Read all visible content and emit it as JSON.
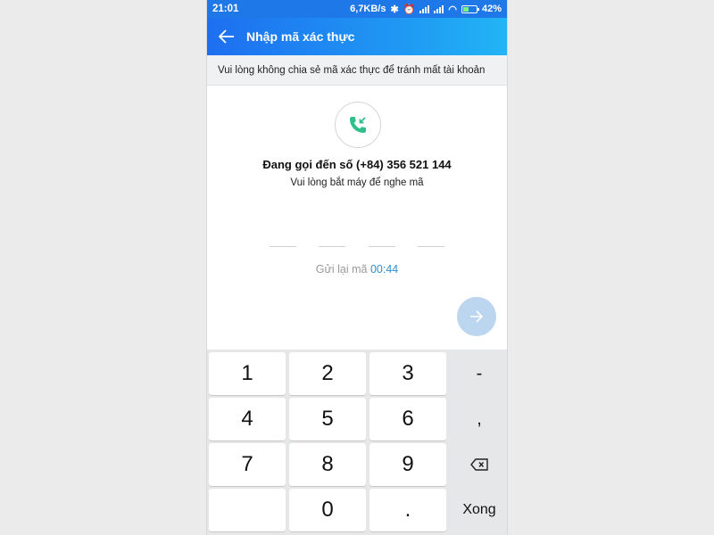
{
  "status_bar": {
    "time": "21:01",
    "speed": "6,7KB/s",
    "battery": "42%"
  },
  "header": {
    "title": "Nhập mã xác thực"
  },
  "notice": "Vui lòng không chia sẻ mã xác thực để tránh mất tài khoản",
  "call": {
    "title": "Đang gọi đến số (+84) 356 521 144",
    "subtitle": "Vui lòng bắt máy để nghe mã"
  },
  "otp_fields": [
    "",
    "",
    "",
    ""
  ],
  "resend": {
    "label": "Gửi lại mã",
    "countdown": "00:44"
  },
  "keypad": {
    "k1": "1",
    "k2": "2",
    "k3": "3",
    "dash": "-",
    "k4": "4",
    "k5": "5",
    "k6": "6",
    "comma": ",",
    "k7": "7",
    "k8": "8",
    "k9": "9",
    "k0": "0",
    "dot": ".",
    "done": "Xong"
  },
  "colors": {
    "accent": "#1f78e8",
    "call_icon": "#2fbf8a",
    "countdown": "#2a8fd6"
  },
  "icons": {
    "back": "arrow-left-icon",
    "call": "incoming-call-icon",
    "next": "arrow-right-icon",
    "backspace": "backspace-icon"
  }
}
